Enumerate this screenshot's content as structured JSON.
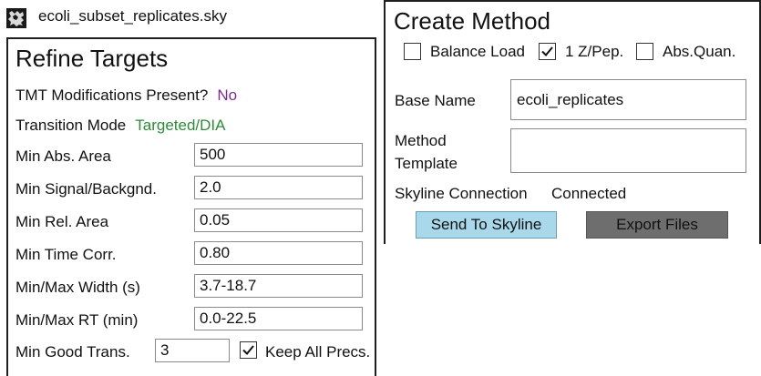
{
  "file": {
    "name": "ecoli_subset_replicates.sky",
    "icon": "skyline-document-icon"
  },
  "refine": {
    "title": "Refine Targets",
    "tmt_label": "TMT Modifications Present?",
    "tmt_value": "No",
    "transition_label": "Transition Mode",
    "transition_value": "Targeted/DIA",
    "fields": [
      {
        "label": "Min Abs. Area",
        "value": "500"
      },
      {
        "label": "Min Signal/Backgnd.",
        "value": "2.0"
      },
      {
        "label": "Min Rel. Area",
        "value": "0.05"
      },
      {
        "label": "Min Time Corr.",
        "value": "0.80"
      },
      {
        "label": "Min/Max Width (s)",
        "value": "3.7-18.7"
      },
      {
        "label": "Min/Max RT (min)",
        "value": "0.0-22.5"
      }
    ],
    "min_good_trans_label": "Min Good Trans.",
    "min_good_trans_value": "3",
    "keep_all_precs_label": "Keep All Precs.",
    "keep_all_precs_checked": true
  },
  "create": {
    "title": "Create Method",
    "options": [
      {
        "label": "Balance Load",
        "checked": false
      },
      {
        "label": "1 Z/Pep.",
        "checked": true
      },
      {
        "label": "Abs.Quan.",
        "checked": false
      }
    ],
    "base_name_label": "Base Name",
    "base_name_value": "ecoli_replicates",
    "method_template_label_1": "Method",
    "method_template_label_2": "Template",
    "method_template_value": "",
    "connection_label": "Skyline Connection",
    "connection_value": "Connected",
    "send_button": "Send To Skyline",
    "export_button": "Export Files"
  },
  "colors": {
    "purple": "#7b2c8e",
    "green": "#2e8b3a",
    "send_bg": "#a8d8ea",
    "export_bg": "#6e6e6e"
  }
}
